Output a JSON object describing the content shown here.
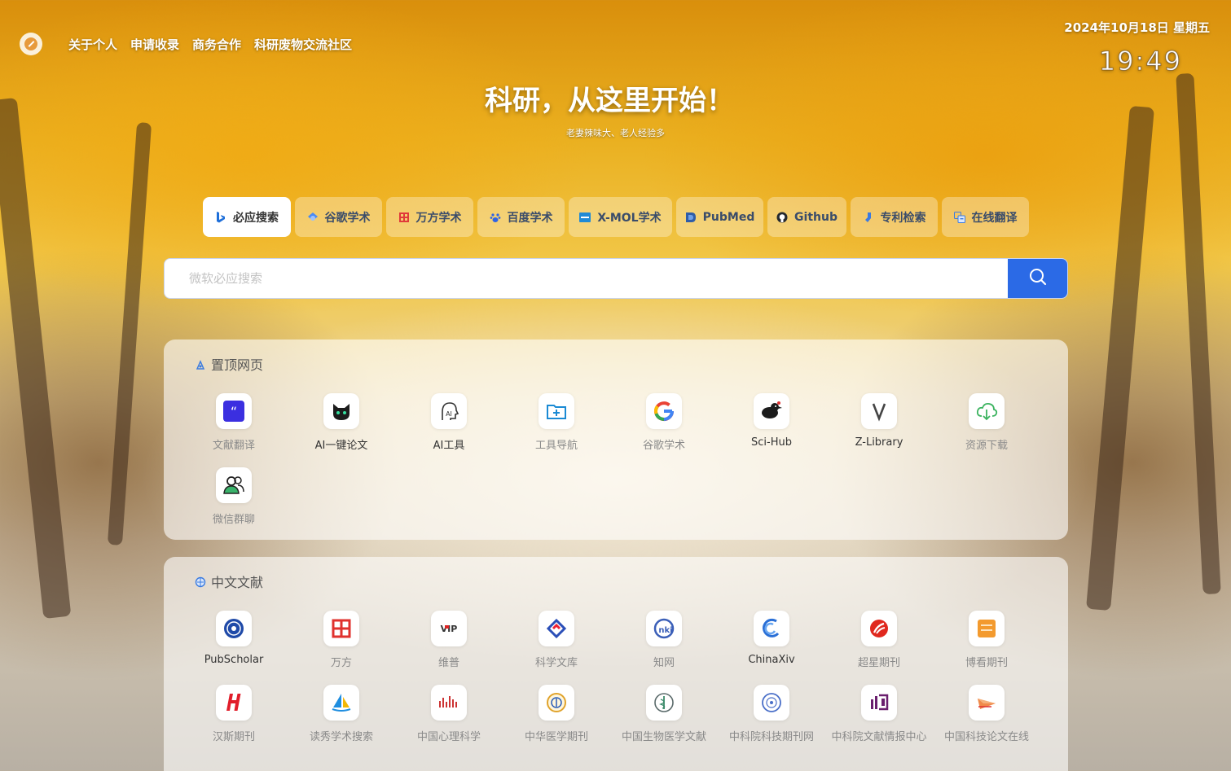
{
  "nav": {
    "links": [
      "关于个人",
      "申请收录",
      "商务合作",
      "科研废物交流社区"
    ]
  },
  "datetime": {
    "date": "2024年10月18日 星期五",
    "time": "19:49"
  },
  "hero": {
    "title": "科研，从这里开始！",
    "subtitle": "老妻辣味大、老人经验多"
  },
  "engines": [
    {
      "label": "必应搜索",
      "icon": "bing-icon",
      "active": true
    },
    {
      "label": "谷歌学术",
      "icon": "google-scholar-icon"
    },
    {
      "label": "万方学术",
      "icon": "wanfang-icon"
    },
    {
      "label": "百度学术",
      "icon": "baidu-paw-icon"
    },
    {
      "label": "X-MOL学术",
      "icon": "xmol-icon"
    },
    {
      "label": "PubMed",
      "icon": "pubmed-icon"
    },
    {
      "label": "Github",
      "icon": "github-icon"
    },
    {
      "label": "专利检索",
      "icon": "patent-icon"
    },
    {
      "label": "在线翻译",
      "icon": "translate-icon"
    }
  ],
  "search": {
    "placeholder": "微软必应搜索",
    "value": ""
  },
  "pinned": {
    "title": "置顶网页",
    "items": [
      {
        "label": "文献翻译",
        "icon": "quote-icon"
      },
      {
        "label": "AI一键论文",
        "icon": "cat-mask-icon"
      },
      {
        "label": "AI工具",
        "icon": "ai-head-icon"
      },
      {
        "label": "工具导航",
        "icon": "folder-plus-icon"
      },
      {
        "label": "谷歌学术",
        "icon": "google-icon"
      },
      {
        "label": "Sci-Hub",
        "icon": "scihub-raven-icon"
      },
      {
        "label": "Z-Library",
        "icon": "zlibrary-icon"
      },
      {
        "label": "资源下载",
        "icon": "cloud-download-icon"
      },
      {
        "label": "微信群聊",
        "icon": "group-chat-icon"
      }
    ]
  },
  "chinese": {
    "title": "中文文献",
    "items": [
      {
        "label": "PubScholar",
        "icon": "pubscholar-icon"
      },
      {
        "label": "万方",
        "icon": "wanfang-logo-icon"
      },
      {
        "label": "维普",
        "icon": "vip-icon"
      },
      {
        "label": "科学文库",
        "icon": "kexue-wenku-icon"
      },
      {
        "label": "知网",
        "icon": "cnki-icon"
      },
      {
        "label": "ChinaXiv",
        "icon": "chinaxiv-icon"
      },
      {
        "label": "超星期刊",
        "icon": "chaoxing-icon"
      },
      {
        "label": "博看期刊",
        "icon": "bookan-icon"
      },
      {
        "label": "汉斯期刊",
        "icon": "hans-icon"
      },
      {
        "label": "读秀学术搜索",
        "icon": "duxiu-sail-icon"
      },
      {
        "label": "中国心理科学",
        "icon": "psych-bars-icon"
      },
      {
        "label": "中华医学期刊",
        "icon": "cma-seal-icon"
      },
      {
        "label": "中国生物医学文献",
        "icon": "sinomed-icon"
      },
      {
        "label": "中科院科技期刊网",
        "icon": "cas-seal-icon"
      },
      {
        "label": "中科院文献情报中心",
        "icon": "las-icon"
      },
      {
        "label": "中国科技论文在线",
        "icon": "paper-plane-icon"
      }
    ]
  }
}
